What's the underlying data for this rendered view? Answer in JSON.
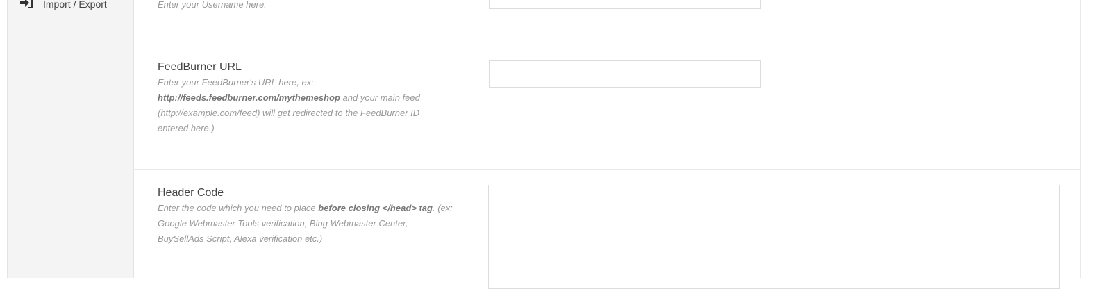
{
  "sidebar": {
    "items": [
      {
        "label": "Import / Export",
        "icon": "import-icon"
      }
    ]
  },
  "settings": {
    "username": {
      "description": "Enter your Username here.",
      "value": ""
    },
    "feedburner_url": {
      "title": "FeedBurner URL",
      "desc_1": "Enter your FeedBurner's URL here, ex:",
      "desc_bold": "http://feeds.feedburner.com/mythemeshop",
      "desc_2": " and your main feed (http://example.com/feed) will get redirected to the FeedBurner ID entered here.)",
      "value": ""
    },
    "header_code": {
      "title": "Header Code",
      "desc_1": "Enter the code which you need to place ",
      "desc_bold_1": "before closing </head> tag",
      "desc_2": ". (ex: Google Webmaster Tools verification, Bing Webmaster Center, BuySellAds Script, Alexa verification etc.)",
      "value": ""
    }
  },
  "colors": {
    "sidebar_bg": "#f4f4f4",
    "text": "#444444",
    "description": "#999999"
  }
}
